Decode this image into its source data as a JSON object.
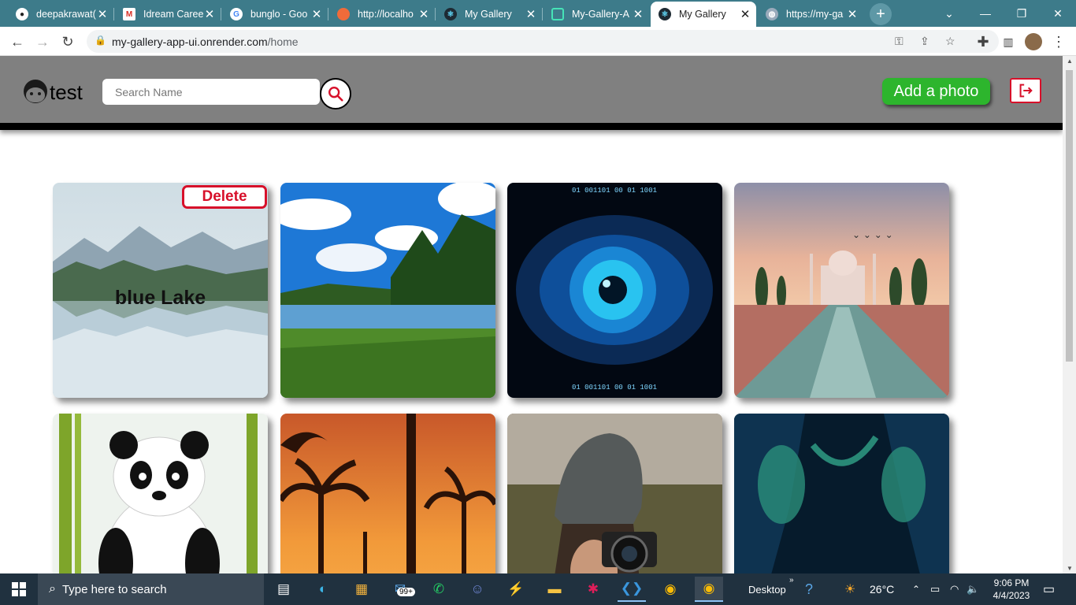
{
  "browser": {
    "tabs": [
      {
        "title": "deepakrawat(",
        "icon": "github-icon",
        "active": false
      },
      {
        "title": "Idream Caree",
        "icon": "gmail-icon",
        "active": false
      },
      {
        "title": "bunglo - Goo",
        "icon": "google-icon",
        "active": false
      },
      {
        "title": "http://localho",
        "icon": "localhost-icon",
        "active": false
      },
      {
        "title": "My Gallery",
        "icon": "react-icon",
        "active": false
      },
      {
        "title": "My-Gallery-A",
        "icon": "render-icon",
        "active": false
      },
      {
        "title": "My Gallery",
        "icon": "react-icon",
        "active": true
      },
      {
        "title": "https://my-ga",
        "icon": "globe-icon",
        "active": false
      }
    ],
    "url_host": "my-gallery-app-ui.onrender.com",
    "url_path": "/home"
  },
  "app": {
    "title": "test",
    "search_placeholder": "Search Name",
    "add_photo_label": "Add a photo",
    "accent": "#2db52d",
    "danger": "#d7102a"
  },
  "gallery": {
    "cards": [
      {
        "caption": "blue Lake",
        "delete_label": "Delete",
        "scene": "misty-lake"
      },
      {
        "caption": "",
        "scene": "forest-lake"
      },
      {
        "caption": "",
        "scene": "digital-eye"
      },
      {
        "caption": "",
        "scene": "taj-mahal"
      },
      {
        "caption": "",
        "scene": "panda"
      },
      {
        "caption": "",
        "scene": "palm-sunset"
      },
      {
        "caption": "",
        "scene": "photographer"
      },
      {
        "caption": "",
        "scene": "aurora-cave"
      }
    ]
  },
  "taskbar": {
    "search_placeholder": "Type here to search",
    "mail_badge": "99+",
    "desktop_label": "Desktop",
    "temperature": "26°C",
    "time": "9:06 PM",
    "date": "4/4/2023"
  }
}
